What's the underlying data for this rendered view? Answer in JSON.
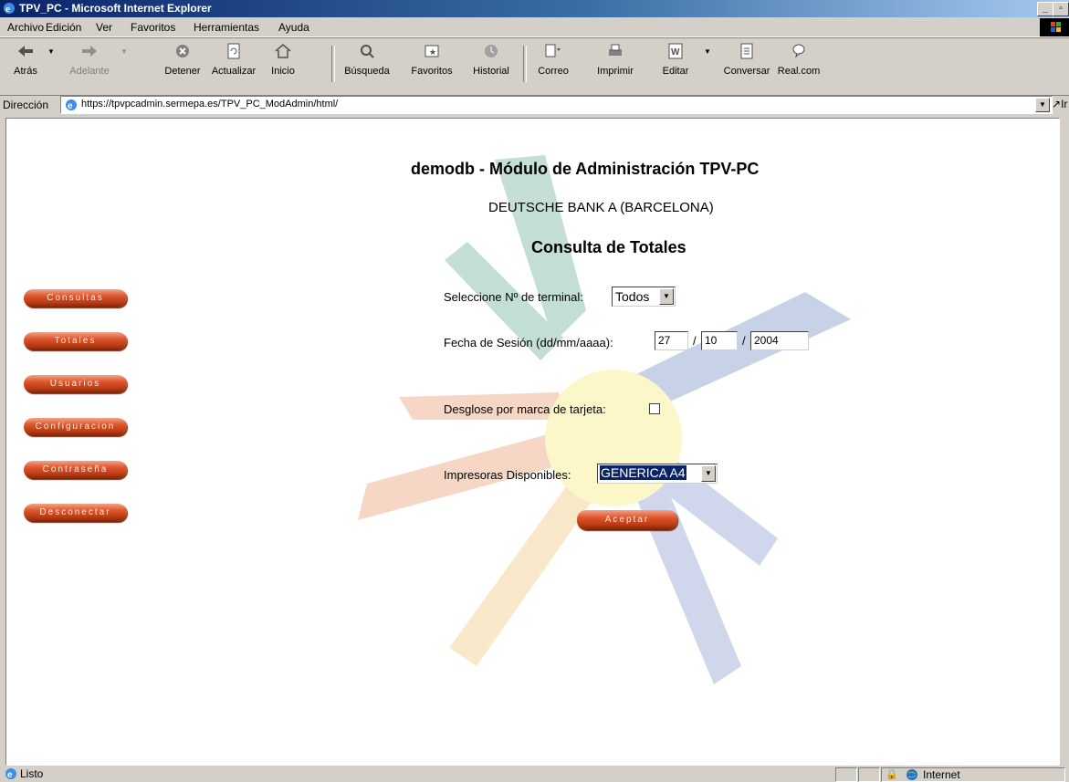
{
  "window": {
    "title": "TPV_PC - Microsoft Internet Explorer"
  },
  "menu": [
    "Archivo",
    "Edición",
    "Ver",
    "Favoritos",
    "Herramientas",
    "Ayuda"
  ],
  "toolbar": {
    "back": "Atrás",
    "forward": "Adelante",
    "stop": "Detener",
    "refresh": "Actualizar",
    "home": "Inicio",
    "search": "Búsqueda",
    "favorites": "Favoritos",
    "history": "Historial",
    "mail": "Correo",
    "print": "Imprimir",
    "edit": "Editar",
    "discuss": "Conversar",
    "realcom": "Real.com"
  },
  "address": {
    "label": "Dirección",
    "url": "https://tpvpcadmin.sermepa.es/TPV_PC_ModAdmin/html/",
    "go": "Ir"
  },
  "nav": [
    "Consultas",
    "Totales",
    "Usuarios",
    "Configuracion",
    "Contraseña",
    "Desconectar"
  ],
  "page": {
    "title": "demodb - Módulo de Administración TPV-PC",
    "bank": "DEUTSCHE BANK A (BARCELONA)",
    "section": "Consulta de Totales"
  },
  "form": {
    "terminal_label": "Seleccione Nº de terminal:",
    "terminal_value": "Todos",
    "date_label": "Fecha de Sesión (dd/mm/aaaa):",
    "day": "27",
    "month": "10",
    "year": "2004",
    "separator": "/",
    "breakdown_label": "Desglose por marca de tarjeta:",
    "breakdown_checked": false,
    "printers_label": "Impresoras Disponibles:",
    "printer_value": "GENERICA A4",
    "submit": "Aceptar"
  },
  "status": {
    "text": "Listo",
    "zone": "Internet"
  },
  "colors": {
    "button": "#d9532a",
    "titlebar": "#0a246a",
    "selected": "#0a246a"
  }
}
